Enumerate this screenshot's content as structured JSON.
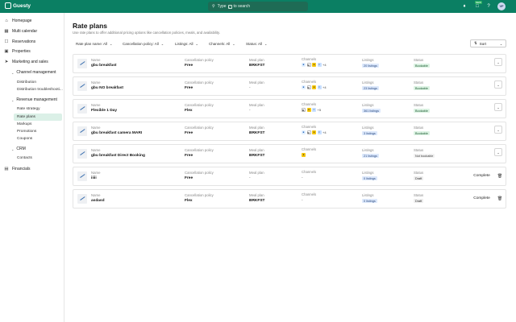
{
  "app": {
    "name": "Guesty",
    "search_placeholder_pre": "Type",
    "search_key": "/",
    "search_placeholder_post": "to search",
    "new_badge": "NEW",
    "avatar_initials": "VF"
  },
  "sidebar": {
    "homepage": "Homepage",
    "multi_calendar": "Multi calendar",
    "reservations": "Reservations",
    "properties": "Properties",
    "marketing": "Marketing and sales",
    "channel_management": "Channel management",
    "distribution": "Distribution",
    "distribution_troubleshooting": "Distribution troubleshooti...",
    "revenue_management": "Revenue management",
    "rate_strategy": "Rate strategy",
    "rate_plans": "Rate plans",
    "markups": "Markups",
    "promotions": "Promotions",
    "coupons": "Coupons",
    "crm": "CRM",
    "contacts": "Contacts",
    "financials": "Financials"
  },
  "page": {
    "title": "Rate plans",
    "subtitle": "Use rate plans to offer additional pricing options like cancellation policies, meals, and availability."
  },
  "filters": {
    "rate_plan_name": "Rate plan name: All",
    "cancellation_policy": "Cancellation policy: All",
    "listings": "Listings: All",
    "channels": "Channels: All",
    "status": "Status: All",
    "sort": "Sort"
  },
  "labels": {
    "name": "Name",
    "cancellation_policy": "Cancellation policy",
    "meal_plan": "Meal plan",
    "channels": "Channels",
    "listings": "Listings",
    "status": "Status",
    "complete": "Complete"
  },
  "rows": [
    {
      "name": "gbu breakfast",
      "cancellation": "Free",
      "meal": "BRKFST",
      "channels_more": "+4",
      "listings": "20 listings",
      "status": "Bookable"
    },
    {
      "name": "gbu NO breakfast",
      "cancellation": "Free",
      "meal": "-",
      "channels_more": "+4",
      "listings": "23 listings",
      "status": "Bookable"
    },
    {
      "name": "Flexible 1 Day",
      "cancellation": "Flex",
      "meal": "-",
      "channels_more": "+5",
      "listings": "361 listings",
      "status": "Bookable"
    },
    {
      "name": "gbu breakfast camera MARI",
      "cancellation": "Free",
      "meal": "BRKFST",
      "channels_more": "+4",
      "listings": "3 listings",
      "status": "Bookable"
    },
    {
      "name": "gbu breakfast Direct Booking",
      "cancellation": "Free",
      "meal": "BRKFST",
      "channels_more": "",
      "listings": "21 listings",
      "status": "Not bookable"
    },
    {
      "name": "iiiii",
      "cancellation": "Free",
      "meal": "-",
      "channels_more": "",
      "channels_dash": "-",
      "listings": "0 listings",
      "status": "Draft"
    },
    {
      "name": "asdasd",
      "cancellation": "Flex",
      "meal": "BRKFST",
      "channels_more": "",
      "channels_dash": "-",
      "listings": "0 listings",
      "status": "Draft"
    }
  ]
}
